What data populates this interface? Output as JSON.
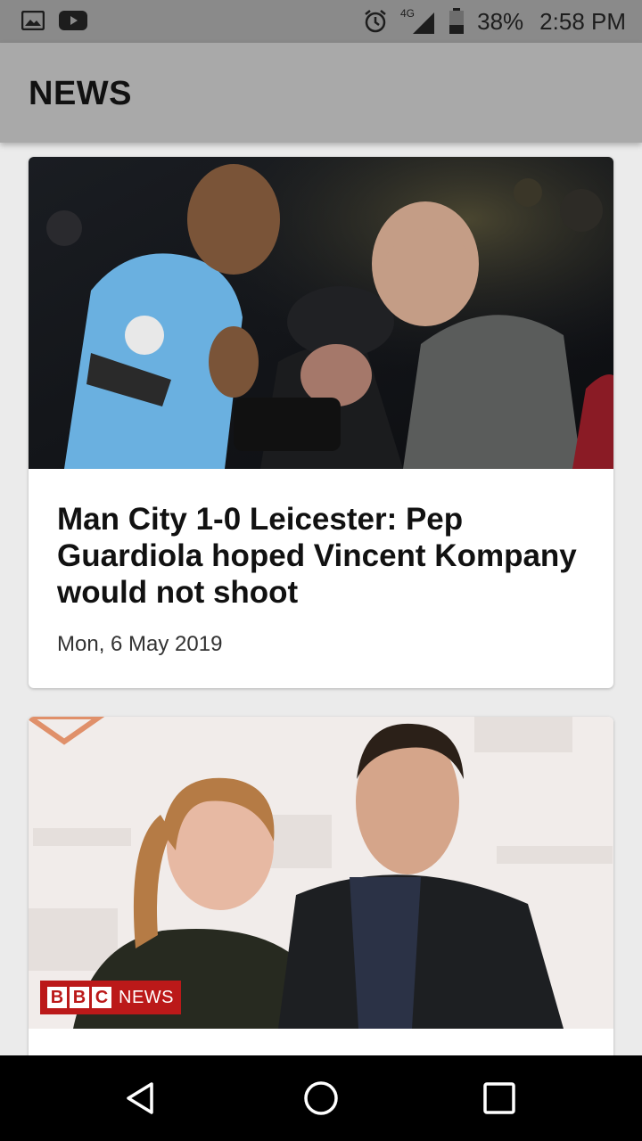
{
  "status_bar": {
    "battery": "38%",
    "time": "2:58 PM",
    "network": "4G",
    "icons": [
      "gallery-icon",
      "youtube-icon",
      "alarm-icon",
      "signal-icon",
      "battery-icon"
    ]
  },
  "app_bar": {
    "title": "NEWS"
  },
  "articles": [
    {
      "title": "Man City 1-0 Leicester: Pep Guardiola hoped Vincent Kompany would not shoot",
      "date": "Mon, 6 May 2019"
    },
    {
      "badge_box_1": "B",
      "badge_box_2": "B",
      "badge_box_3": "C",
      "badge_text": "NEWS"
    }
  ],
  "nav_bar": {
    "icons": [
      "back-icon",
      "home-icon",
      "recents-icon"
    ]
  },
  "colors": {
    "status_bar": "#8a8a8a",
    "app_bar": "#a9a9a9",
    "background": "#ebebeb",
    "bbc_red": "#bb1919"
  }
}
